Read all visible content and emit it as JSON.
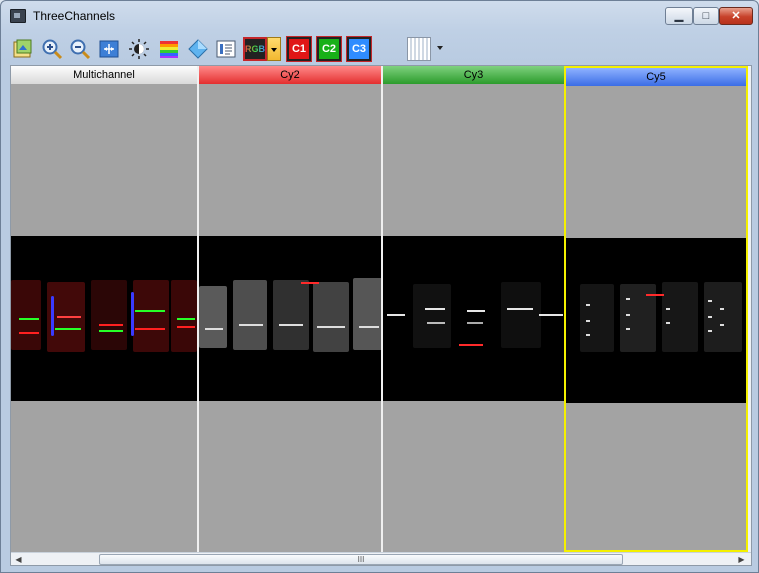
{
  "window": {
    "title": "ThreeChannels",
    "minimize": "▁",
    "maximize": "□",
    "close": "✕"
  },
  "toolbar": {
    "rgb_label": "RGB",
    "channels": [
      "C1",
      "C2",
      "C3"
    ],
    "icons": [
      "open-image-icon",
      "zoom-in-icon",
      "zoom-out-icon",
      "fit-to-window-icon",
      "brightness-icon",
      "color-palette-icon",
      "diamond-tool-icon",
      "image-info-icon",
      "rgb-mode-icon",
      "c1-channel-icon",
      "c2-channel-icon",
      "c3-channel-icon",
      "layout-icon"
    ]
  },
  "panes": [
    {
      "label": "Multichannel",
      "color": "#e0e0e0"
    },
    {
      "label": "Cy2",
      "color": "#e42f2f"
    },
    {
      "label": "Cy3",
      "color": "#2c9b2c"
    },
    {
      "label": "Cy5",
      "color": "#3b6de6"
    }
  ],
  "selected_pane": "Cy5",
  "scrollbar": {
    "grip": "III"
  }
}
